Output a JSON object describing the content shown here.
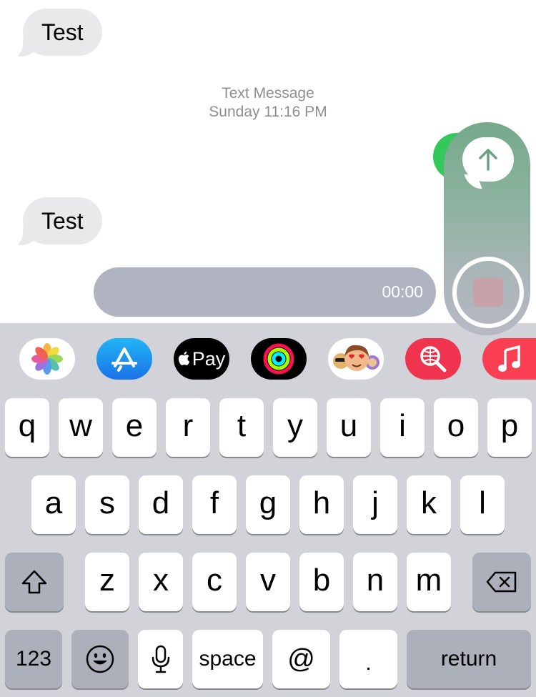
{
  "thread": {
    "messages": [
      {
        "text": "Test"
      },
      {
        "text": "Test"
      }
    ],
    "timestamp": {
      "service": "Text Message",
      "time": "Sunday 11:16 PM"
    }
  },
  "recording": {
    "elapsed": "00:00"
  },
  "app_drawer": {
    "apps": [
      "photos-app-icon",
      "app-store-icon",
      "apple-pay-icon",
      "activity-icon",
      "memoji-icon",
      "images-search-icon",
      "music-icon"
    ],
    "apple_pay_label": "Pay"
  },
  "keyboard": {
    "row1": [
      "q",
      "w",
      "e",
      "r",
      "t",
      "y",
      "u",
      "i",
      "o",
      "p"
    ],
    "row2": [
      "a",
      "s",
      "d",
      "f",
      "g",
      "h",
      "j",
      "k",
      "l"
    ],
    "row3": [
      "z",
      "x",
      "c",
      "v",
      "b",
      "n",
      "m"
    ],
    "numbers_label": "123",
    "space_label": "space",
    "at_label": "@",
    "period_label": ".",
    "return_label": "return"
  },
  "colors": {
    "incoming_bubble": "#e9e9eb",
    "imessage_green": "#34c759",
    "keyboard_bg": "#d1d3d9",
    "key_light": "#ffffff",
    "key_dark": "#abb0ba",
    "audio_bar": "#b0b3c0"
  }
}
